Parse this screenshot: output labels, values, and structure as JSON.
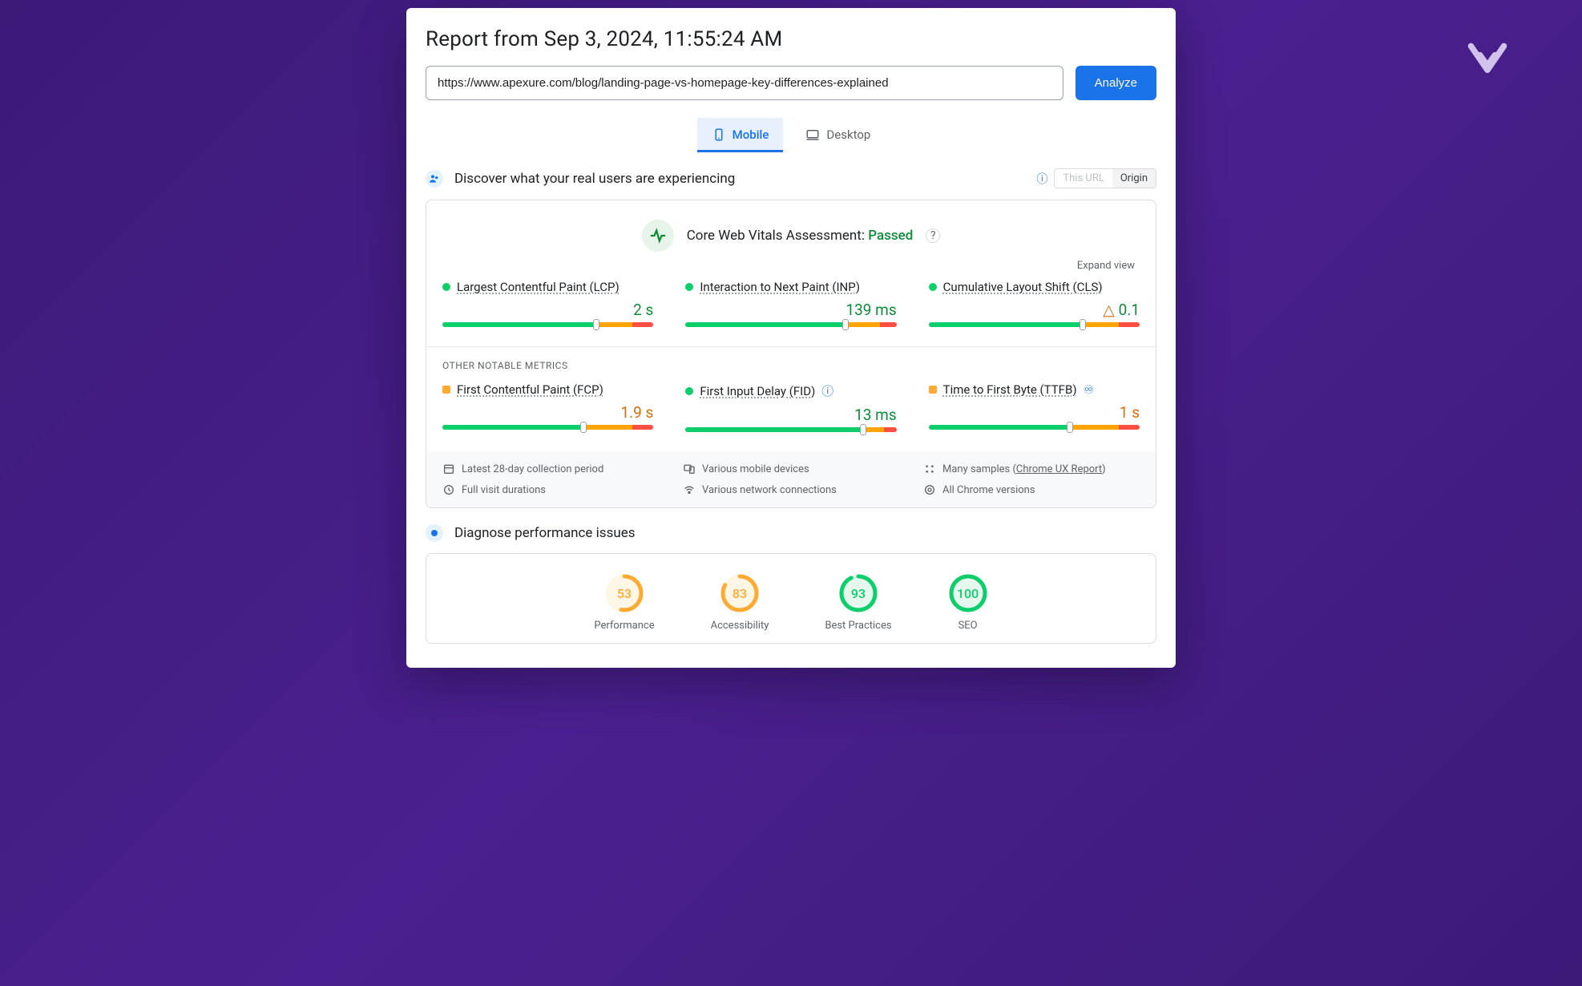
{
  "report_title": "Report from Sep 3, 2024, 11:55:24 AM",
  "url_value": "https://www.apexure.com/blog/landing-page-vs-homepage-key-differences-explained",
  "analyze_label": "Analyze",
  "tabs": {
    "mobile": "Mobile",
    "desktop": "Desktop"
  },
  "discover": {
    "heading": "Discover what your real users are experiencing",
    "toggle_disabled": "This URL",
    "toggle_active": "Origin"
  },
  "cwv": {
    "label": "Core Web Vitals Assessment:",
    "status": "Passed",
    "expand": "Expand view"
  },
  "other_heading": "OTHER NOTABLE METRICS",
  "metrics": {
    "lcp": {
      "name": "Largest Contentful Paint (LCP)",
      "value": "2 s",
      "marker": 73,
      "g": 74,
      "o": 16,
      "r": 10,
      "dot": "green",
      "valcolor": "green"
    },
    "inp": {
      "name": "Interaction to Next Paint (INP)",
      "value": "139 ms",
      "marker": 76,
      "g": 77,
      "o": 15,
      "r": 8,
      "dot": "green",
      "valcolor": "green"
    },
    "cls": {
      "name": "Cumulative Layout Shift (CLS)",
      "value": "0.1",
      "marker": 73,
      "g": 74,
      "o": 16,
      "r": 10,
      "dot": "green",
      "valcolor": "green",
      "warn": true
    },
    "fcp": {
      "name": "First Contentful Paint (FCP)",
      "value": "1.9 s",
      "marker": 67,
      "g": 68,
      "o": 22,
      "r": 10,
      "dot": "orange",
      "valcolor": "orange"
    },
    "fid": {
      "name": "First Input Delay (FID)",
      "value": "13 ms",
      "marker": 84,
      "g": 85,
      "o": 9,
      "r": 6,
      "dot": "green",
      "valcolor": "green",
      "info": true
    },
    "ttfb": {
      "name": "Time to First Byte (TTFB)",
      "value": "1 s",
      "marker": 67,
      "g": 68,
      "o": 22,
      "r": 10,
      "dot": "orange",
      "valcolor": "orange",
      "flask": true
    }
  },
  "footnotes": {
    "period": "Latest 28-day collection period",
    "devices": "Various mobile devices",
    "samples_prefix": "Many samples",
    "samples_link": "Chrome UX Report",
    "durations": "Full visit durations",
    "networks": "Various network connections",
    "versions": "All Chrome versions"
  },
  "diagnose": {
    "heading": "Diagnose performance issues"
  },
  "gauges": [
    {
      "label": "Performance",
      "score": 53,
      "color": "#fa3",
      "bg": "#fff7e5"
    },
    {
      "label": "Accessibility",
      "score": 83,
      "color": "#fa3",
      "bg": "#fff7e5"
    },
    {
      "label": "Best Practices",
      "score": 93,
      "color": "#0cce6b",
      "bg": "#e6f8ee"
    },
    {
      "label": "SEO",
      "score": 100,
      "color": "#0cce6b",
      "bg": "#e6f8ee"
    }
  ]
}
